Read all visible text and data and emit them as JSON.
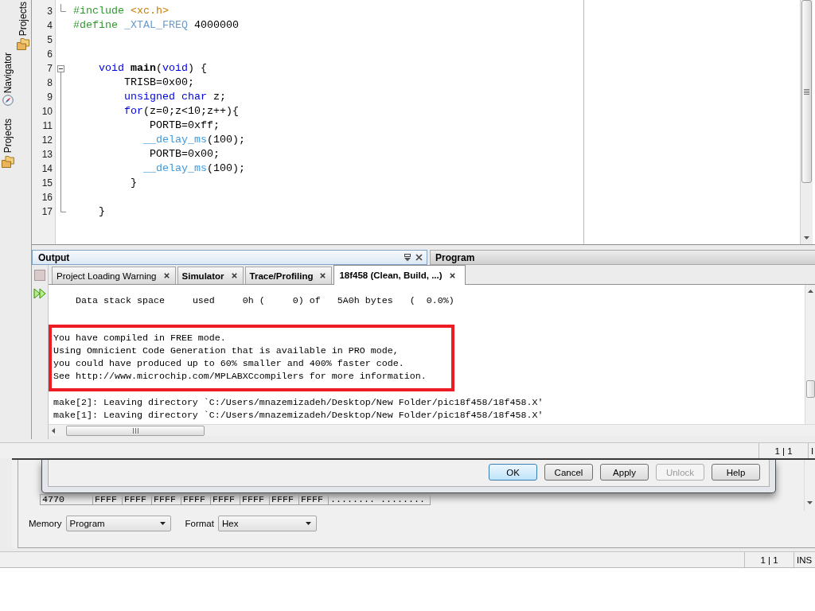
{
  "sidebar": {
    "top_tabs": [
      {
        "kind": "projects",
        "label": "Projects"
      }
    ],
    "tabs": [
      {
        "kind": "navigator",
        "label": "Navigator"
      },
      {
        "kind": "projects",
        "label": "Projects"
      }
    ]
  },
  "editor": {
    "lines": [
      {
        "number": "3",
        "kind": "closer",
        "tokens": [
          {
            "kind": "preprocessor",
            "text": "#include"
          },
          {
            "kind": "header",
            "text": " <xc.h>"
          }
        ]
      },
      {
        "number": "4",
        "kind": "plain",
        "tokens": [
          {
            "kind": "preprocessor",
            "text": "#define"
          },
          {
            "kind": "macro",
            "text": " _XTAL_FREQ"
          },
          {
            "kind": "plain",
            "text": " 4000000"
          }
        ]
      },
      {
        "number": "5",
        "kind": "plain"
      },
      {
        "number": "6",
        "kind": "plain"
      },
      {
        "number": "7",
        "kind": "opener",
        "tokens": [
          {
            "kind": "keyword",
            "text": "    void"
          },
          {
            "kind": "function",
            "text": " main"
          },
          {
            "kind": "plain",
            "text": "("
          },
          {
            "kind": "keyword",
            "text": "void"
          },
          {
            "kind": "plain",
            "text": ") {"
          }
        ]
      },
      {
        "number": "8",
        "kind": "inner",
        "tokens": [
          {
            "kind": "plain",
            "text": "        TRISB=0x00;"
          }
        ]
      },
      {
        "number": "9",
        "kind": "inner",
        "tokens": [
          {
            "kind": "keyword",
            "text": "        unsigned char"
          },
          {
            "kind": "plain",
            "text": " z;"
          }
        ]
      },
      {
        "number": "10",
        "kind": "inner",
        "tokens": [
          {
            "kind": "keyword",
            "text": "        for"
          },
          {
            "kind": "plain",
            "text": "(z=0;z<10;z++){"
          }
        ]
      },
      {
        "number": "11",
        "kind": "inner",
        "tokens": [
          {
            "kind": "plain",
            "text": "            PORTB=0xff;"
          }
        ]
      },
      {
        "number": "12",
        "kind": "inner",
        "tokens": [
          {
            "kind": "builtin",
            "text": "           __delay_ms"
          },
          {
            "kind": "plain",
            "text": "(100);"
          }
        ]
      },
      {
        "number": "13",
        "kind": "inner",
        "tokens": [
          {
            "kind": "plain",
            "text": "            PORTB=0x00;"
          }
        ]
      },
      {
        "number": "14",
        "kind": "inner",
        "tokens": [
          {
            "kind": "builtin",
            "text": "           __delay_ms"
          },
          {
            "kind": "plain",
            "text": "(100);"
          }
        ]
      },
      {
        "number": "15",
        "kind": "inner",
        "tokens": [
          {
            "kind": "plain",
            "text": "         }"
          }
        ]
      },
      {
        "number": "16",
        "kind": "inner"
      },
      {
        "number": "17",
        "kind": "closer",
        "tokens": [
          {
            "kind": "plain",
            "text": "    }"
          }
        ]
      }
    ]
  },
  "output_panel": {
    "title": "Output",
    "toolbar": [
      {
        "kind": "stop",
        "disabled": true
      },
      {
        "kind": "rerun",
        "disabled": false
      }
    ],
    "tabs": [
      {
        "label": "Project Loading Warning",
        "unread": false,
        "selected": false
      },
      {
        "label": "Simulator",
        "unread": true,
        "selected": false
      },
      {
        "label": "Trace/Profiling",
        "unread": true,
        "selected": false
      },
      {
        "label": "18f458 (Clean, Build, ...)",
        "unread": true,
        "selected": true
      }
    ],
    "blocks": [
      {
        "kind": "plain",
        "lines": [
          "    Data stack space     used     0h (     0) of   5A0h bytes   (  0.0%)"
        ]
      },
      {
        "kind": "highlighted",
        "lines": [
          "You have compiled in FREE mode.",
          "Using Omnicient Code Generation that is available in PRO mode,",
          "you could have produced up to 60% smaller and 400% faster code.",
          "See http://www.microchip.com/MPLABXCcompilers for more information."
        ]
      },
      {
        "kind": "plain",
        "lines": [
          "make[2]: Leaving directory `C:/Users/mnazemizadeh/Desktop/New Folder/pic18f458/18f458.X'",
          "make[1]: Leaving directory `C:/Users/mnazemizadeh/Desktop/New Folder/pic18f458/18f458.X'"
        ]
      }
    ]
  },
  "program_panel": {
    "title": "Program"
  },
  "status_bar": {
    "position": "1 | 1",
    "mode": "I"
  },
  "memory_window": {
    "dialog_buttons": [
      {
        "label": "OK",
        "default": true,
        "disabled": false
      },
      {
        "label": "Cancel",
        "default": false,
        "disabled": false
      },
      {
        "label": "Apply",
        "default": false,
        "disabled": false
      },
      {
        "label": "Unlock",
        "default": false,
        "disabled": true
      },
      {
        "label": "Help",
        "default": false,
        "disabled": false
      }
    ],
    "rows": [
      {
        "address": "4770",
        "cells": [
          "FFFF",
          "FFFF",
          "FFFF",
          "FFFF",
          "FFFF",
          "FFFF",
          "FFFF",
          "FFFF"
        ],
        "ascii": "........ ........"
      }
    ],
    "fields": [
      {
        "label": "Memory",
        "value": "Program"
      },
      {
        "label": "Format",
        "value": "Hex"
      }
    ]
  },
  "status_bar_2": {
    "position": "1 | 1",
    "mode": "INS"
  }
}
